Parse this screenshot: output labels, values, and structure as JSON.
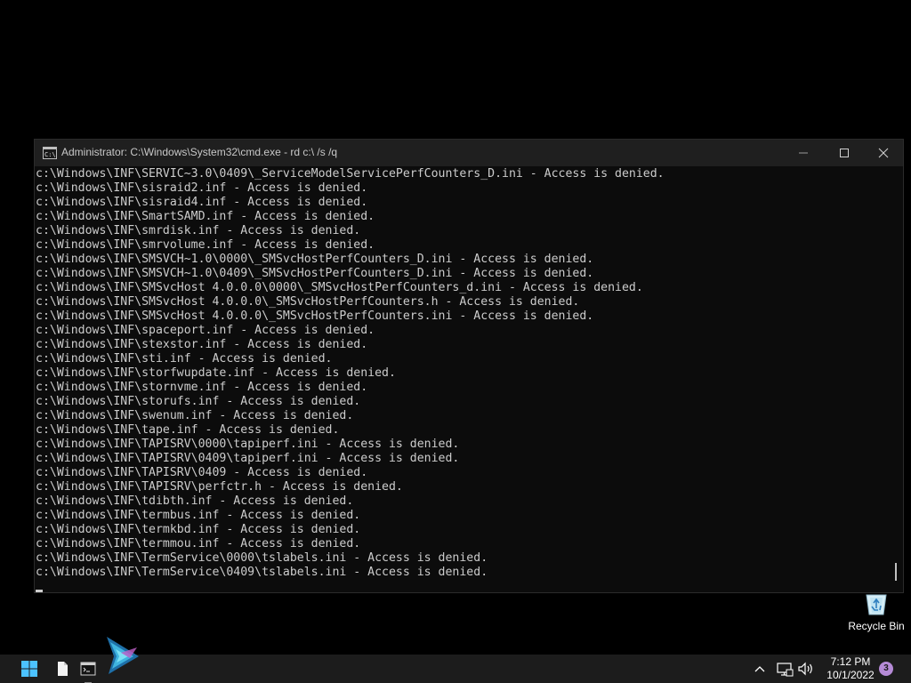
{
  "window": {
    "title": "Administrator: C:\\Windows\\System32\\cmd.exe - rd  c:\\ /s /q"
  },
  "console": {
    "lines": [
      "c:\\Windows\\INF\\SERVIC~3.0\\0409\\_ServiceModelServicePerfCounters_D.ini - Access is denied.",
      "c:\\Windows\\INF\\sisraid2.inf - Access is denied.",
      "c:\\Windows\\INF\\sisraid4.inf - Access is denied.",
      "c:\\Windows\\INF\\SmartSAMD.inf - Access is denied.",
      "c:\\Windows\\INF\\smrdisk.inf - Access is denied.",
      "c:\\Windows\\INF\\smrvolume.inf - Access is denied.",
      "c:\\Windows\\INF\\SMSVCH~1.0\\0000\\_SMSvcHostPerfCounters_D.ini - Access is denied.",
      "c:\\Windows\\INF\\SMSVCH~1.0\\0409\\_SMSvcHostPerfCounters_D.ini - Access is denied.",
      "c:\\Windows\\INF\\SMSvcHost 4.0.0.0\\0000\\_SMSvcHostPerfCounters_d.ini - Access is denied.",
      "c:\\Windows\\INF\\SMSvcHost 4.0.0.0\\_SMSvcHostPerfCounters.h - Access is denied.",
      "c:\\Windows\\INF\\SMSvcHost 4.0.0.0\\_SMSvcHostPerfCounters.ini - Access is denied.",
      "c:\\Windows\\INF\\spaceport.inf - Access is denied.",
      "c:\\Windows\\INF\\stexstor.inf - Access is denied.",
      "c:\\Windows\\INF\\sti.inf - Access is denied.",
      "c:\\Windows\\INF\\storfwupdate.inf - Access is denied.",
      "c:\\Windows\\INF\\stornvme.inf - Access is denied.",
      "c:\\Windows\\INF\\storufs.inf - Access is denied.",
      "c:\\Windows\\INF\\swenum.inf - Access is denied.",
      "c:\\Windows\\INF\\tape.inf - Access is denied.",
      "c:\\Windows\\INF\\TAPISRV\\0000\\tapiperf.ini - Access is denied.",
      "c:\\Windows\\INF\\TAPISRV\\0409\\tapiperf.ini - Access is denied.",
      "c:\\Windows\\INF\\TAPISRV\\0409 - Access is denied.",
      "c:\\Windows\\INF\\TAPISRV\\perfctr.h - Access is denied.",
      "c:\\Windows\\INF\\tdibth.inf - Access is denied.",
      "c:\\Windows\\INF\\termbus.inf - Access is denied.",
      "c:\\Windows\\INF\\termkbd.inf - Access is denied.",
      "c:\\Windows\\INF\\termmou.inf - Access is denied.",
      "c:\\Windows\\INF\\TermService\\0000\\tslabels.ini - Access is denied.",
      "c:\\Windows\\INF\\TermService\\0409\\tslabels.ini - Access is denied."
    ]
  },
  "desktop": {
    "recycle_bin_label": "Recycle Bin"
  },
  "taskbar": {
    "icons": [
      "start-icon",
      "file-explorer-icon",
      "command-prompt-icon",
      "media-app-icon"
    ],
    "tray_icons": [
      "chevron-up-icon",
      "network-icon",
      "volume-icon"
    ],
    "clock_time": "7:12 PM",
    "clock_date": "10/1/2022",
    "notification_count": "3"
  },
  "colors": {
    "console_background": "#0c0c0c",
    "console_text": "#cccccc",
    "titlebar": "#1f1f1f",
    "taskbar": "#1c1c1c",
    "start_blue": "#4cc2ff",
    "badge": "#b58ad6"
  }
}
